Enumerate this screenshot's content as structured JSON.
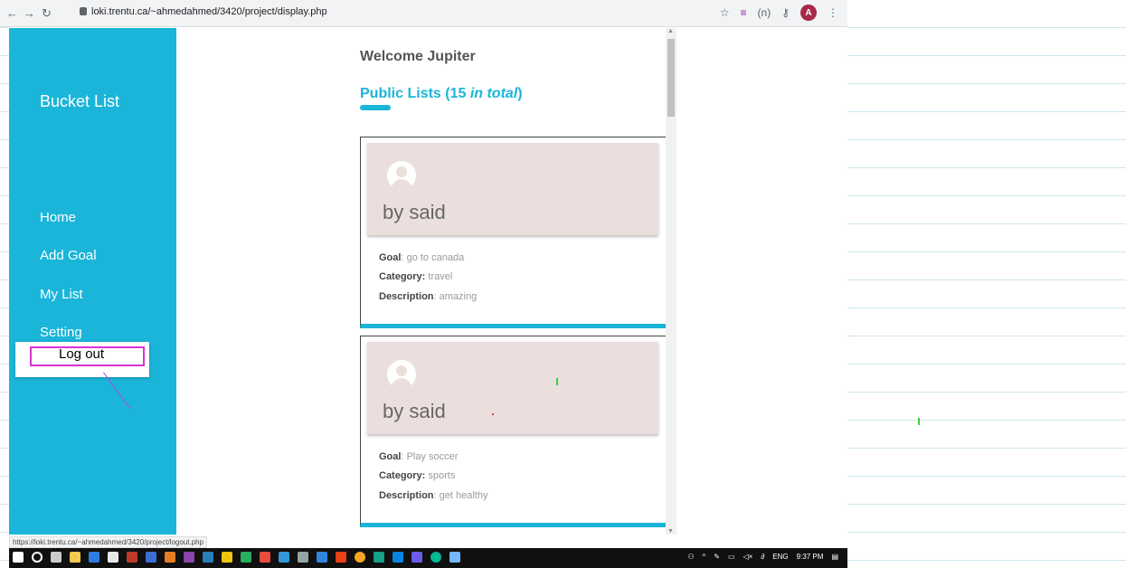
{
  "browser": {
    "url": "loki.trentu.ca/~ahmedahmed/3420/project/display.php",
    "profile_initial": "A",
    "extension_label": "(n)"
  },
  "sidebar": {
    "brand": "Bucket List",
    "items": [
      {
        "label": "Home"
      },
      {
        "label": "Add Goal"
      },
      {
        "label": "My List"
      },
      {
        "label": "Setting"
      }
    ],
    "dropdown_item": "Log out"
  },
  "main": {
    "welcome": "Welcome Jupiter",
    "public_prefix": "Public Lists (15 ",
    "public_count_text": "in total",
    "public_suffix": ")",
    "cards": [
      {
        "author": "by said",
        "goal_label": "Goal",
        "goal": "go to canada",
        "category_label": "Category:",
        "category": "travel",
        "description_label": "Description",
        "description": "amazing"
      },
      {
        "author": "by said",
        "goal_label": "Goal",
        "goal": "Play soccer",
        "category_label": "Category:",
        "category": "sports",
        "description_label": "Description",
        "description": "get healthy"
      }
    ]
  },
  "status_bar": {
    "hover_url": "https://loki.trentu.ca/~ahmedahmed/3420/project/logout.php"
  },
  "taskbar": {
    "language": "ENG",
    "time": "9:37 PM"
  },
  "colors": {
    "accent": "#1bb5d9",
    "highlight": "#d633d6",
    "card_header": "#ebdfde"
  }
}
